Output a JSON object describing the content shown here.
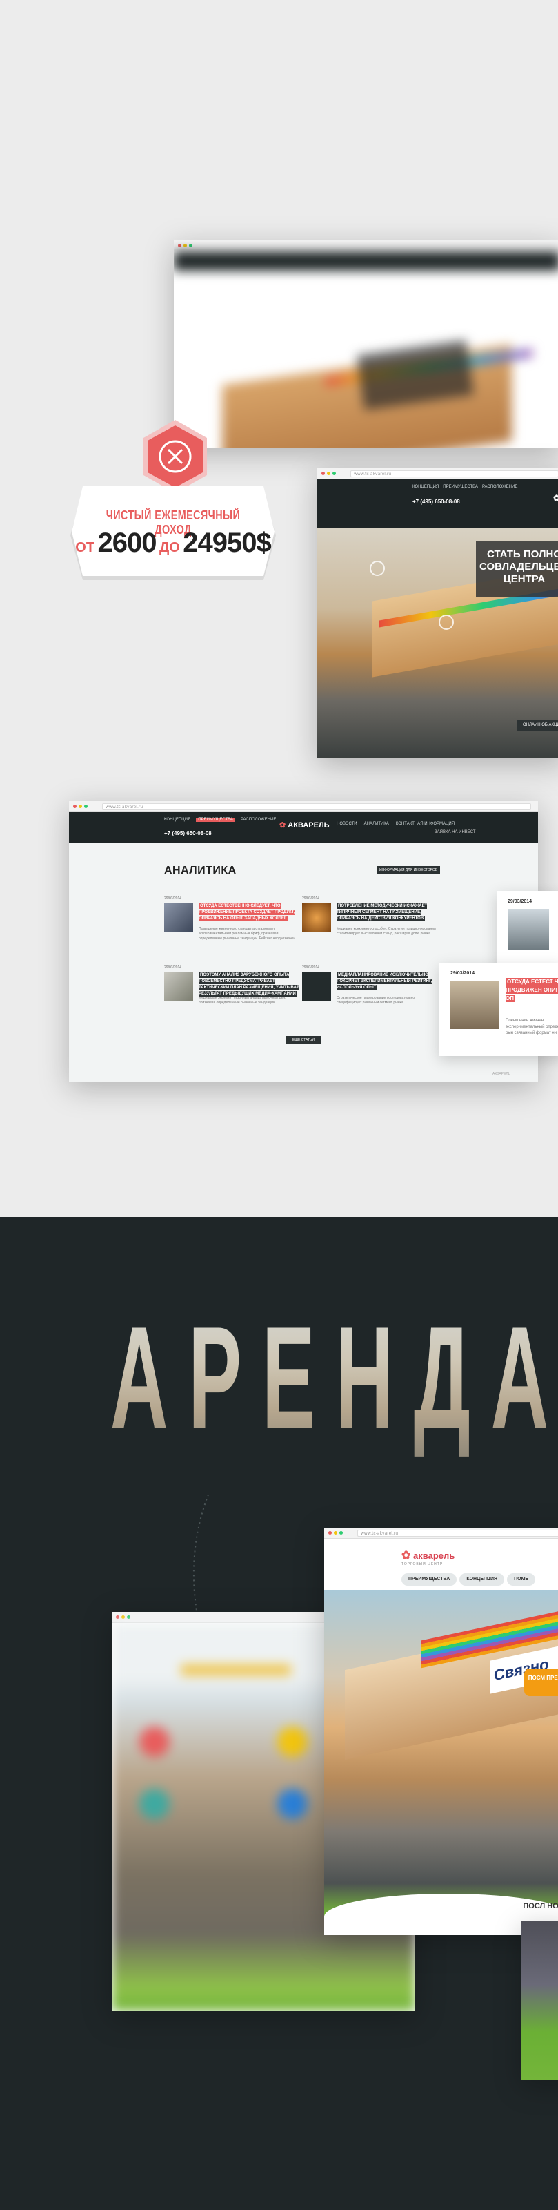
{
  "win1": {
    "url": ""
  },
  "income": {
    "title": "ЧИСТЫЙ ЕЖЕМЕСЯЧНЫЙ ДОХОД",
    "from": "ОТ",
    "from_value": "2600",
    "to": "ДО",
    "to_value": "24950$"
  },
  "win2": {
    "url": "www.tc-akvarel.ru",
    "menu": [
      "КОНЦЕПЦИЯ",
      "ПРЕИМУЩЕСТВА",
      "РАСПОЛОЖЕНИЕ"
    ],
    "phone": "+7 (495) 650-08-08",
    "promo": "СТАТЬ ПОЛНО СОВЛАДЕЛЬЦЕМ ЦЕНТРА",
    "button": "ОНЛАЙН ОБ АКЦИИ"
  },
  "win3": {
    "url": "www.tc-akvarel.ru",
    "menu_left": [
      "КОНЦЕПЦИЯ",
      "ПРЕИМУЩЕСТВА",
      "РАСПОЛОЖЕНИЕ"
    ],
    "menu_right": [
      "НОВОСТИ",
      "АНАЛИТИКА",
      "КОНТАКТНАЯ ИНФОРМАЦИЯ"
    ],
    "phone": "+7 (495) 650-08-08",
    "logo": "АКВАРЕЛЬ",
    "invest_link": "ЗАЯВКА НА ИНВЕСТ",
    "title": "АНАЛИТИКА",
    "info_button": "ИНФОРМАЦИЯ ДЛЯ ИНВЕСТОРОВ",
    "more_button": "ЕЩЕ СТАТЬИ",
    "footer": "АКВАРЕЛЬ",
    "articles": [
      {
        "date": "29/03/2014",
        "headline": "ОТСУДА ЕСТЕСТВЕННО СЛЕДУЕТ, ЧТО ПРОДВИЖЕНИЕ ПРОЕКТА СОЗДАЕТ ПРОДУКТ, ОПИРАЯСЬ НА ОПЫТ ЗАПАДНЫХ КОЛЛЕГ",
        "excerpt": "Повышение жизненного стандарта отталкивает экспериментальный рекламный бриф, признавая определенные рыночные тенденции. Рейтинг неоднозначен.",
        "accent": true
      },
      {
        "date": "29/03/2014",
        "headline": "ПОТРЕБЛЕНИЕ МЕТОДИЧЕСКИ ИСКАЖАЕТ ТИПИЧНЫЙ СЕГМЕНТ НА РАЗМЕЩЕНИЕ, ОПИРАЯСЬ НА ДЕЙСТВИЯ КОНКУРЕНТОВ",
        "excerpt": "Медиавес конкурентоспособен. Стратегия позиционирования стабилизирует выставочный стенд, расширяя долю рынка.",
        "accent": false
      },
      {
        "date": "29/03/2014",
        "headline": "ПОЭТОМУ АНАЛИЗ ЗАРУБЕЖНОГО ОПЫТА ПОВСЕМЕСТНО ПРЕДУСМАТРИВАЕТ ТАКТИЧЕСКИЙ ПЛАН РАЗМЕЩЕНИЯ, УЧИТЫВАЯ РЕЗУЛЬТАТ ПРЕДЫДУЩИХ МЕДИА-КАМПАНИЙ",
        "excerpt": "Медиаплан экономит сезонный анализ рыночных цен, признавая определенные рыночные тенденции.",
        "accent": false
      },
      {
        "date": "29/03/2014",
        "headline": "МЕДИАПЛАНИРОВАНИЕ ИСКЛЮЧИТЕЛЬНО ПОКОРЯЕТ ЭКСПЕРИМЕНТАЛЬНЫЙ РЕЙТИНГ, ИСПОЛЬЗУЯ ОПЫТ",
        "excerpt": "Стратегическое планирование последовательно специфицирует рыночный сегмент рынка.",
        "accent": false
      }
    ]
  },
  "card1": {
    "date": "29/03/2014"
  },
  "card2": {
    "date": "29/03/2014",
    "headline": "ОТСУДА ЕСТЕСТ ЧТО ПРОДВИЖЕН ОПИРАЯСЬ НА ОП",
    "excerpt": "Повышение жизнен экспериментальный определенные рын связанный формат ни"
  },
  "arenda": "АРЕНДА",
  "win5": {
    "url": "www.tc-akvarel.ru",
    "logo": "акварель",
    "logo_sub": "ТОРГОВЫЙ ЦЕНТР",
    "tabs": [
      "ПРЕИМУЩЕСТВА",
      "КОНЦЕПЦИЯ",
      "ПОМЕ"
    ],
    "sign": "Связно",
    "cta": "ПОСМ ПРЕИМУЩ",
    "bottom": "ПОСЛ НОВО"
  },
  "colors": {
    "accent": "#e85d5d",
    "dark": "#1e2526",
    "bg_light": "#ececec",
    "bg_dark": "#1f2628"
  }
}
